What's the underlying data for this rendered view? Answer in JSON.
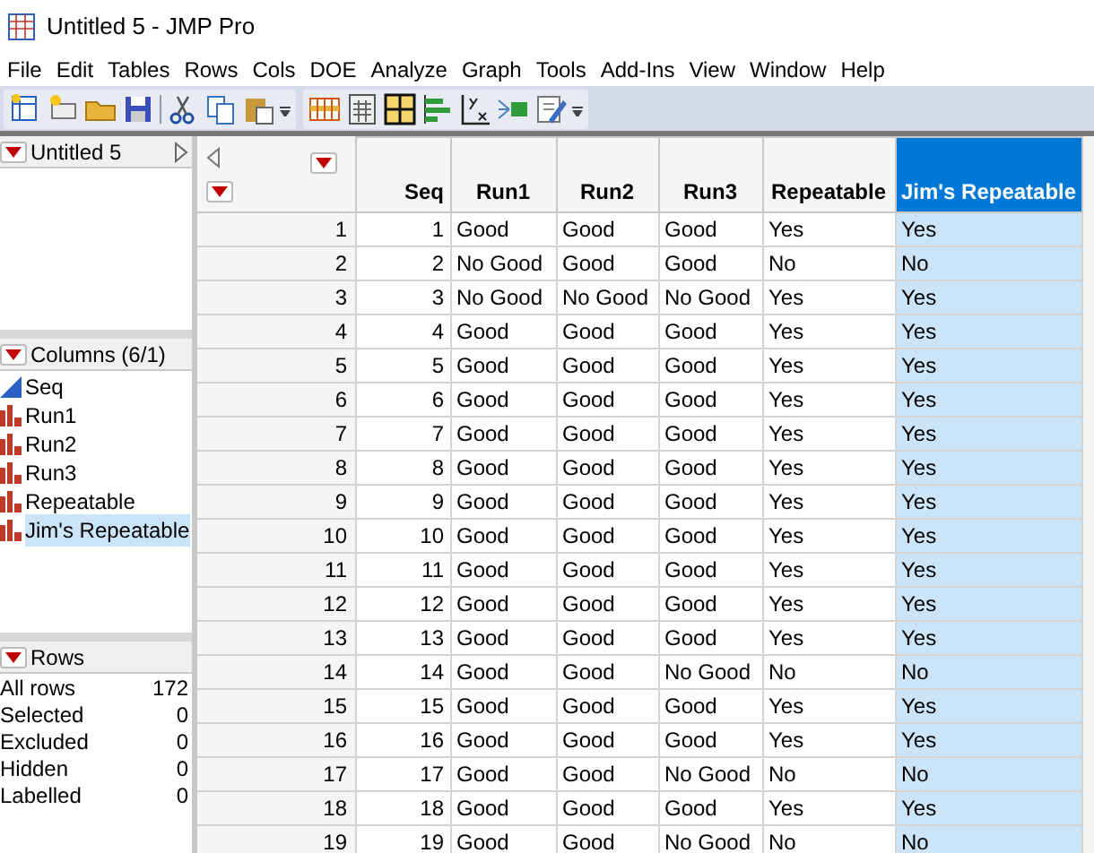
{
  "window": {
    "title": "Untitled 5 - JMP Pro"
  },
  "menu": [
    "File",
    "Edit",
    "Tables",
    "Rows",
    "Cols",
    "DOE",
    "Analyze",
    "Graph",
    "Tools",
    "Add-Ins",
    "View",
    "Window",
    "Help"
  ],
  "table_panel": {
    "title": "Untitled 5"
  },
  "columns_panel": {
    "title": "Columns (6/1)",
    "items": [
      {
        "name": "Seq",
        "kind": "continuous",
        "selected": false
      },
      {
        "name": "Run1",
        "kind": "nominal",
        "selected": false
      },
      {
        "name": "Run2",
        "kind": "nominal",
        "selected": false
      },
      {
        "name": "Run3",
        "kind": "nominal",
        "selected": false
      },
      {
        "name": "Repeatable",
        "kind": "nominal",
        "selected": false
      },
      {
        "name": "Jim's Repeatable",
        "kind": "nominal",
        "selected": true
      }
    ]
  },
  "rows_panel": {
    "title": "Rows",
    "stats": [
      {
        "label": "All rows",
        "value": "172"
      },
      {
        "label": "Selected",
        "value": "0"
      },
      {
        "label": "Excluded",
        "value": "0"
      },
      {
        "label": "Hidden",
        "value": "0"
      },
      {
        "label": "Labelled",
        "value": "0"
      }
    ]
  },
  "table": {
    "columns": [
      {
        "name": "Seq",
        "kind": "numeric",
        "selected": false
      },
      {
        "name": "Run1",
        "kind": "text",
        "selected": false
      },
      {
        "name": "Run2",
        "kind": "text",
        "selected": false
      },
      {
        "name": "Run3",
        "kind": "text",
        "selected": false
      },
      {
        "name": "Repeatable",
        "kind": "text",
        "selected": false
      },
      {
        "name": "Jim's Repeatable",
        "kind": "text",
        "selected": true
      }
    ],
    "rows": [
      {
        "number": "1",
        "cells": [
          "1",
          "Good",
          "Good",
          "Good",
          "Yes",
          "Yes"
        ]
      },
      {
        "number": "2",
        "cells": [
          "2",
          "No Good",
          "Good",
          "Good",
          "No",
          "No"
        ]
      },
      {
        "number": "3",
        "cells": [
          "3",
          "No Good",
          "No Good",
          "No Good",
          "Yes",
          "Yes"
        ]
      },
      {
        "number": "4",
        "cells": [
          "4",
          "Good",
          "Good",
          "Good",
          "Yes",
          "Yes"
        ]
      },
      {
        "number": "5",
        "cells": [
          "5",
          "Good",
          "Good",
          "Good",
          "Yes",
          "Yes"
        ]
      },
      {
        "number": "6",
        "cells": [
          "6",
          "Good",
          "Good",
          "Good",
          "Yes",
          "Yes"
        ]
      },
      {
        "number": "7",
        "cells": [
          "7",
          "Good",
          "Good",
          "Good",
          "Yes",
          "Yes"
        ]
      },
      {
        "number": "8",
        "cells": [
          "8",
          "Good",
          "Good",
          "Good",
          "Yes",
          "Yes"
        ]
      },
      {
        "number": "9",
        "cells": [
          "9",
          "Good",
          "Good",
          "Good",
          "Yes",
          "Yes"
        ]
      },
      {
        "number": "10",
        "cells": [
          "10",
          "Good",
          "Good",
          "Good",
          "Yes",
          "Yes"
        ]
      },
      {
        "number": "11",
        "cells": [
          "11",
          "Good",
          "Good",
          "Good",
          "Yes",
          "Yes"
        ]
      },
      {
        "number": "12",
        "cells": [
          "12",
          "Good",
          "Good",
          "Good",
          "Yes",
          "Yes"
        ]
      },
      {
        "number": "13",
        "cells": [
          "13",
          "Good",
          "Good",
          "Good",
          "Yes",
          "Yes"
        ]
      },
      {
        "number": "14",
        "cells": [
          "14",
          "Good",
          "Good",
          "No Good",
          "No",
          "No"
        ]
      },
      {
        "number": "15",
        "cells": [
          "15",
          "Good",
          "Good",
          "Good",
          "Yes",
          "Yes"
        ]
      },
      {
        "number": "16",
        "cells": [
          "16",
          "Good",
          "Good",
          "Good",
          "Yes",
          "Yes"
        ]
      },
      {
        "number": "17",
        "cells": [
          "17",
          "Good",
          "Good",
          "No Good",
          "No",
          "No"
        ]
      },
      {
        "number": "18",
        "cells": [
          "18",
          "Good",
          "Good",
          "Good",
          "Yes",
          "Yes"
        ]
      },
      {
        "number": "19",
        "cells": [
          "19",
          "Good",
          "Good",
          "No Good",
          "No",
          "No"
        ]
      }
    ]
  }
}
